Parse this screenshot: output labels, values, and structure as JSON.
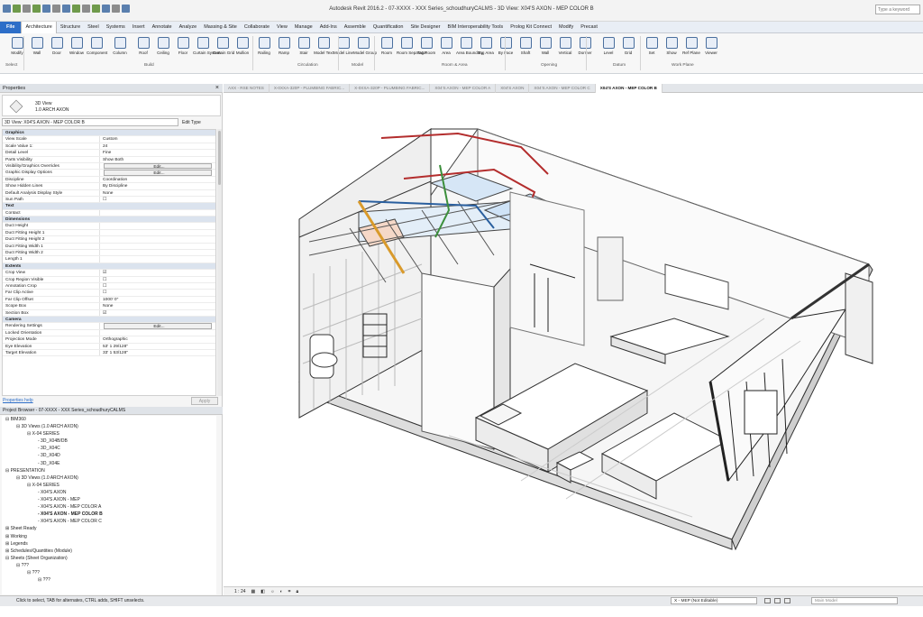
{
  "window": {
    "title": "Autodesk Revit 2016.2 - 07-XXXX - XXX Series_schoudhuryCALMS - 3D View: X04'S AXON - MEP COLOR B",
    "help_placeholder": "Type a keyword"
  },
  "ribbon_tabs": [
    "File",
    "Architecture",
    "Structure",
    "Steel",
    "Systems",
    "Insert",
    "Annotate",
    "Analyze",
    "Massing & Site",
    "Collaborate",
    "View",
    "Manage",
    "Add-Ins",
    "Assemble",
    "Quantification",
    "Site Designer",
    "BIM Interoperability Tools",
    "Prolog Kit Connect",
    "Modify",
    "Precast"
  ],
  "ribbon_buttons": [
    "Modify",
    "Wall",
    "Door",
    "Window",
    "Component",
    "Column",
    "Roof",
    "Ceiling",
    "Floor",
    "Curtain System",
    "Curtain Grid",
    "Mullion",
    "Railing",
    "Ramp",
    "Stair",
    "Model Text",
    "Model Line",
    "Model Group",
    "Room",
    "Room Separator",
    "Tag Room",
    "Area",
    "Area Boundary",
    "Tag Area",
    "By Face",
    "Shaft",
    "Wall",
    "Vertical",
    "Dormer",
    "Level",
    "Grid",
    "Set",
    "Show",
    "Ref Plane",
    "Viewer"
  ],
  "ribbon_panels": [
    "Select",
    "Build",
    "Circulation",
    "Model",
    "Room & Area",
    "Opening",
    "Datum",
    "Work Plane"
  ],
  "properties": {
    "header": "Properties",
    "type_line1": "3D View",
    "type_line2": "1.0 ARCH AXON",
    "selector": "3D View: X04'S AXON - MEP COLOR B",
    "edit_type": "Edit Type",
    "rows": [
      [
        "sec",
        "Graphics",
        ""
      ],
      [
        "",
        "View Scale",
        "Custom"
      ],
      [
        "",
        "Scale Value 1:",
        "24"
      ],
      [
        "",
        "Detail Level",
        "Fine"
      ],
      [
        "",
        "Parts Visibility",
        "Show Both"
      ],
      [
        "btn",
        "Visibility/Graphics Overrides",
        "Edit..."
      ],
      [
        "btn",
        "Graphic Display Options",
        "Edit..."
      ],
      [
        "",
        "Discipline",
        "Coordination"
      ],
      [
        "",
        "Show Hidden Lines",
        "By Discipline"
      ],
      [
        "",
        "Default Analysis Display Style",
        "None"
      ],
      [
        "",
        "Sun Path",
        "☐"
      ],
      [
        "sec",
        "Text",
        ""
      ],
      [
        "",
        "Contact",
        ""
      ],
      [
        "sec",
        "Dimensions",
        ""
      ],
      [
        "",
        "Duct Height",
        ""
      ],
      [
        "",
        "Duct Fitting Height 1",
        ""
      ],
      [
        "",
        "Duct Fitting Height 2",
        ""
      ],
      [
        "",
        "Duct Fitting Width 1",
        ""
      ],
      [
        "",
        "Duct Fitting Width 2",
        ""
      ],
      [
        "",
        "Length 1",
        ""
      ],
      [
        "sec",
        "Extents",
        ""
      ],
      [
        "",
        "Crop View",
        "☑"
      ],
      [
        "",
        "Crop Region Visible",
        "☐"
      ],
      [
        "",
        "Annotation Crop",
        "☐"
      ],
      [
        "",
        "Far Clip Active",
        "☐"
      ],
      [
        "",
        "Far Clip Offset",
        "1000' 0\""
      ],
      [
        "",
        "Scope Box",
        "None"
      ],
      [
        "",
        "Section Box",
        "☑"
      ],
      [
        "sec",
        "Camera",
        ""
      ],
      [
        "btn",
        "Rendering Settings",
        "Edit..."
      ],
      [
        "",
        "Locked Orientation",
        ""
      ],
      [
        "",
        "Projection Mode",
        "Orthographic"
      ],
      [
        "",
        "Eye Elevation",
        "53' 1 29/128\""
      ],
      [
        "",
        "Target Elevation",
        "33' 1 53/128\""
      ]
    ],
    "help_link": "Properties help",
    "apply": "Apply"
  },
  "browser": {
    "header": "Project Browser - 07-XXXX - XXX Series_schoudhuryCALMS",
    "nodes": [
      [
        "0",
        "⊟ BIM360"
      ],
      [
        "1",
        "⊟ 3D Views (1.0 ARCH AXON)"
      ],
      [
        "2",
        "⊟ X-04 SERIES"
      ],
      [
        "3",
        "- 3D_X04B/DB"
      ],
      [
        "3",
        "- 3D_X04C"
      ],
      [
        "3",
        "- 3D_X04D"
      ],
      [
        "3",
        "- 3D_X04E"
      ],
      [
        "0",
        "⊟ PRESENTATION"
      ],
      [
        "1",
        "⊟ 3D Views (1.0 ARCH AXON)"
      ],
      [
        "2",
        "⊟ X-04 SERIES"
      ],
      [
        "3",
        "- X04'S AXON"
      ],
      [
        "3",
        "- X04'S AXON - MEP"
      ],
      [
        "3",
        "- X04'S AXON - MEP COLOR A"
      ],
      [
        "3b",
        "- X04'S AXON - MEP COLOR B"
      ],
      [
        "3",
        "- X04'S AXON - MEP COLOR C"
      ],
      [
        "0",
        "⊞ Sheet Ready"
      ],
      [
        "0",
        "⊞ Working"
      ],
      [
        "0",
        "⊞ Legends"
      ],
      [
        "0",
        "⊞ Schedules/Quantities (Module)"
      ],
      [
        "0",
        "⊟ Sheets (Sheet Organization)"
      ],
      [
        "1",
        "⊟ ???"
      ],
      [
        "2",
        "⊟ ???"
      ],
      [
        "3",
        "⊟ ???"
      ]
    ]
  },
  "view_tabs": [
    "AXX - RSE NOTES",
    "X-0XXA-320P - PLUMBING FABRIC...",
    "X-0XXA-320P - PLUMBING FABRIC...",
    "X04'S AXON - MEP COLOR A",
    "X04'S AXON",
    "X04'S AXON - MEP COLOR C",
    "X04'S AXON - MEP COLOR B"
  ],
  "view_control": {
    "scale": "1 : 24"
  },
  "status": {
    "text": "Click to select, TAB for alternates, CTRL adds, SHIFT unselects.",
    "workset": "X - MEP (Not Editable)",
    "model": "Main Model"
  }
}
